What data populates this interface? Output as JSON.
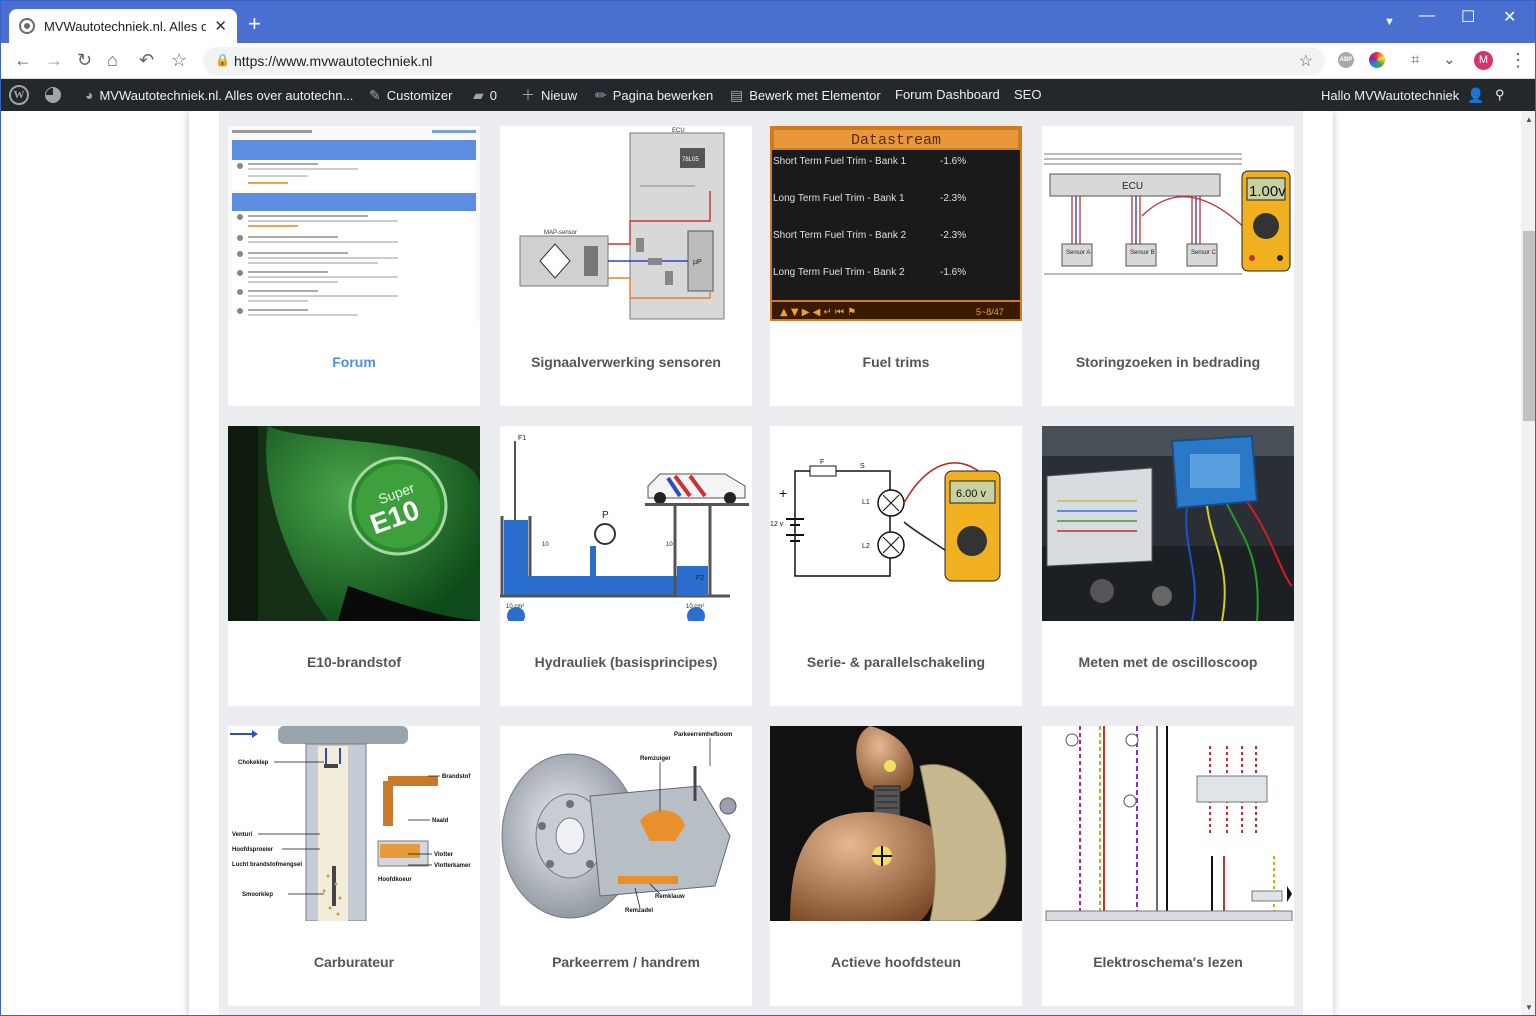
{
  "browser": {
    "tab_title": "MVWautotechniek.nl. Alles over a",
    "tab_close": "✕",
    "new_tab": "+",
    "url": "https://www.mvwautotechniek.nl",
    "avatar_letter": "M",
    "abp_label": "ABP",
    "window_controls": {
      "minimize": "—",
      "maximize": "☐",
      "close": "✕"
    }
  },
  "adminbar": {
    "site_name": "MVWautotechniek.nl. Alles over autotechn...",
    "customizer": "Customizer",
    "comments_count": "0",
    "new": "Nieuw",
    "edit_page": "Pagina bewerken",
    "elementor": "Bewerk met Elementor",
    "forum_dashboard": "Forum Dashboard",
    "seo": "SEO",
    "greeting": "Hallo MVWautotechniek"
  },
  "cards": [
    {
      "label": "Forum",
      "link": true,
      "icon": "forum-screenshot"
    },
    {
      "label": "Signaalverwerking sensoren",
      "link": false,
      "icon": "ecu-sensor-diagram"
    },
    {
      "label": "Fuel trims",
      "link": false,
      "icon": "datastream-display"
    },
    {
      "label": "Storingzoeken in bedrading",
      "link": false,
      "icon": "ecu-wiring-multimeter"
    },
    {
      "label": "E10-brandstof",
      "link": false,
      "icon": "fuel-nozzle-e10"
    },
    {
      "label": "Hydrauliek (basisprincipes)",
      "link": false,
      "icon": "hydraulic-diagram"
    },
    {
      "label": "Serie- & parallelschakeling",
      "link": false,
      "icon": "circuit-multimeter"
    },
    {
      "label": "Meten met de oscilloscoop",
      "link": false,
      "icon": "oscilloscope-engine"
    },
    {
      "label": "Carburateur",
      "link": false,
      "icon": "carburettor-diagram"
    },
    {
      "label": "Parkeerrem / handrem",
      "link": false,
      "icon": "brake-caliper"
    },
    {
      "label": "Actieve hoofdsteun",
      "link": false,
      "icon": "crash-dummy-seat"
    },
    {
      "label": "Elektroschema's lezen",
      "link": false,
      "icon": "wiring-schematic"
    }
  ],
  "images": {
    "datastream": {
      "title": "Datastream",
      "rows": [
        {
          "name": "Short Term Fuel Trim - Bank 1",
          "value": "-1.6%"
        },
        {
          "name": "Long Term Fuel Trim - Bank 1",
          "value": "-2.3%"
        },
        {
          "name": "Short Term Fuel Trim - Bank 2",
          "value": "-2.3%"
        },
        {
          "name": "Long Term Fuel Trim - Bank 2",
          "value": "-1.6%"
        }
      ],
      "page": "5~8/47"
    },
    "ecu_label": "ECU",
    "multimeter_1": "1.00v",
    "multimeter_2": "6.00 v",
    "sensors": [
      "Sensor A",
      "Sensor B",
      "Sensor C"
    ],
    "e10_text": "Super E10",
    "map_sensor": "MAP-sensor",
    "regulator": "78L05",
    "up_label": "µP",
    "parkeerrem": [
      "Parkeerremhefboom",
      "Remzuiger",
      "Remklauw",
      "Remzadel"
    ],
    "carb_labels": [
      "Chokeklep",
      "Brandstof",
      "Naald",
      "Venturi",
      "Hoofdsproeier",
      "Vlotter",
      "Vlotterkamer",
      "Lucht brandstofmengsel",
      "Hoofdkoeur",
      "Smoorklep"
    ],
    "circuit_labels": {
      "f": "F",
      "s": "S",
      "l1": "L1",
      "l2": "L2",
      "v": "12 v"
    },
    "hydraulic_labels": {
      "f1": "F1",
      "p": "P",
      "h1": "10",
      "h2": "10",
      "a1": "10 cm²",
      "a2": "10 cm²",
      "f2": "F2"
    }
  }
}
